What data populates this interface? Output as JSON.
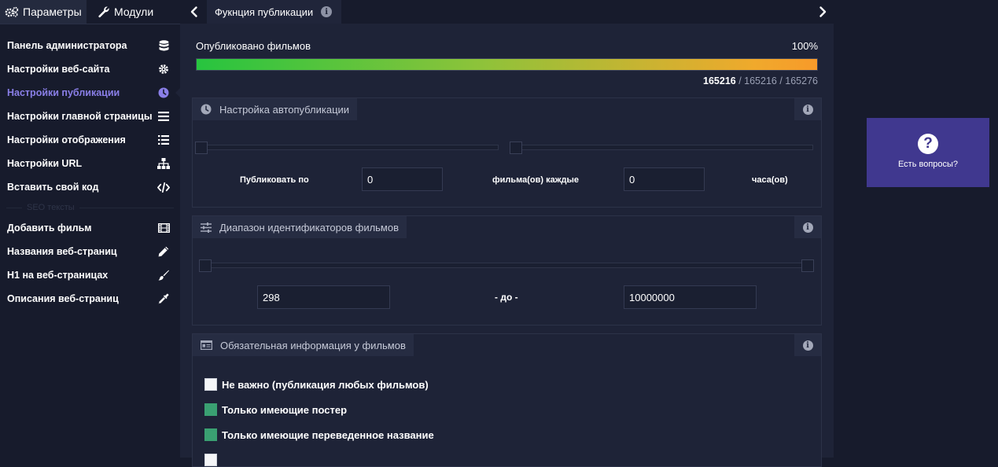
{
  "sidebar": {
    "tabs": [
      {
        "label": "Параметры",
        "icon": "gears-icon"
      },
      {
        "label": "Модули",
        "icon": "wrench-icon"
      }
    ],
    "items": [
      {
        "label": "Панель администратора",
        "icon": "database-icon"
      },
      {
        "label": "Настройки веб-сайта",
        "icon": "gear-icon"
      },
      {
        "label": "Настройки публикации",
        "icon": "clock-icon",
        "active": true
      },
      {
        "label": "Настройки главной страницы",
        "icon": "bars-icon"
      },
      {
        "label": "Настройки отображения",
        "icon": "list-icon"
      },
      {
        "label": "Настройки URL",
        "icon": "sitemap-icon"
      },
      {
        "label": "Вставить свой код",
        "icon": "code-icon"
      }
    ],
    "separator": "SEO тексты",
    "seo_items": [
      {
        "label": "Добавить фильм",
        "icon": "film-icon"
      },
      {
        "label": "Названия веб-страниц",
        "icon": "pencil-icon"
      },
      {
        "label": "H1 на веб-страницах",
        "icon": "brush-icon"
      },
      {
        "label": "Описания веб-страниц",
        "icon": "eyedropper-icon"
      }
    ]
  },
  "header": {
    "title": "Фукнция публикации",
    "info": "i"
  },
  "published": {
    "label": "Опубликовано фильмов",
    "percent_label": "100%",
    "progress": 1.0,
    "count_published": "165216",
    "count_rest": " / 165216 / 165276"
  },
  "autopublish": {
    "title": "Настройка автопубликации",
    "publish_by_label": "Публиковать по",
    "films_value": "0",
    "every_label": "фильма(ов) каждые",
    "hours_value": "0",
    "hours_label": "часа(ов)"
  },
  "id_range": {
    "title": "Диапазон идентификаторов фильмов",
    "from_value": "298",
    "to_label": "- до -",
    "to_value": "10000000"
  },
  "required_info": {
    "title": "Обязательная информация у фильмов",
    "options": [
      {
        "label": "Не важно (публикация любых фильмов)",
        "checked": false
      },
      {
        "label": "Только имеющие постер",
        "checked": true
      },
      {
        "label": "Только имеющие переведенное название",
        "checked": true
      }
    ]
  },
  "help": {
    "icon": "?",
    "label": "Есть вопросы?"
  },
  "colors": {
    "accent": "#8a7fe8",
    "help_bg": "#40388f",
    "checkbox_on": "#3aa072",
    "progress_start": "#27c43f",
    "progress_end": "#f79a2a"
  }
}
